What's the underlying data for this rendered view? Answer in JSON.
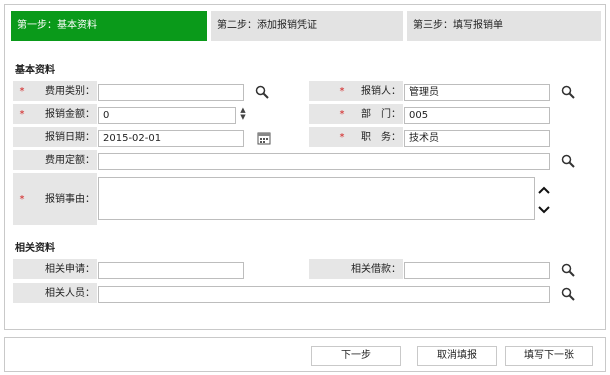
{
  "steps": [
    {
      "label": "第一步：基本资料"
    },
    {
      "label": "第二步：添加报销凭证"
    },
    {
      "label": "第三步：填写报销单"
    }
  ],
  "basic_section": {
    "title": "基本资料",
    "required_mark": "*",
    "fields": {
      "expense_type": {
        "label": "费用类别：",
        "value": ""
      },
      "applicant": {
        "label": "报销人：",
        "value": "管理员"
      },
      "amount": {
        "label": "报销金额：",
        "value": "0"
      },
      "department": {
        "label": "部　门：",
        "value": "005"
      },
      "date": {
        "label": "报销日期：",
        "value": "2015-02-01"
      },
      "position": {
        "label": "职　务：",
        "value": "技术员"
      },
      "quota": {
        "label": "费用定额：",
        "value": ""
      },
      "reason": {
        "label": "报销事由：",
        "value": ""
      }
    }
  },
  "related_section": {
    "title": "相关资料",
    "fields": {
      "related_request": {
        "label": "相关申请：",
        "value": ""
      },
      "related_loan": {
        "label": "相关借款：",
        "value": ""
      },
      "related_person": {
        "label": "相关人员：",
        "value": ""
      }
    }
  },
  "buttons": {
    "next": "下一步",
    "cancel": "取消填报",
    "fill_next": "填写下一张"
  },
  "icons": {
    "search": "search-icon",
    "calendar": "calendar-icon",
    "spinner": "stepper-icon",
    "scroll": "scroll-arrows-icon"
  },
  "colors": {
    "active_step": "#0a9a1a",
    "required": "#d21e1e"
  }
}
